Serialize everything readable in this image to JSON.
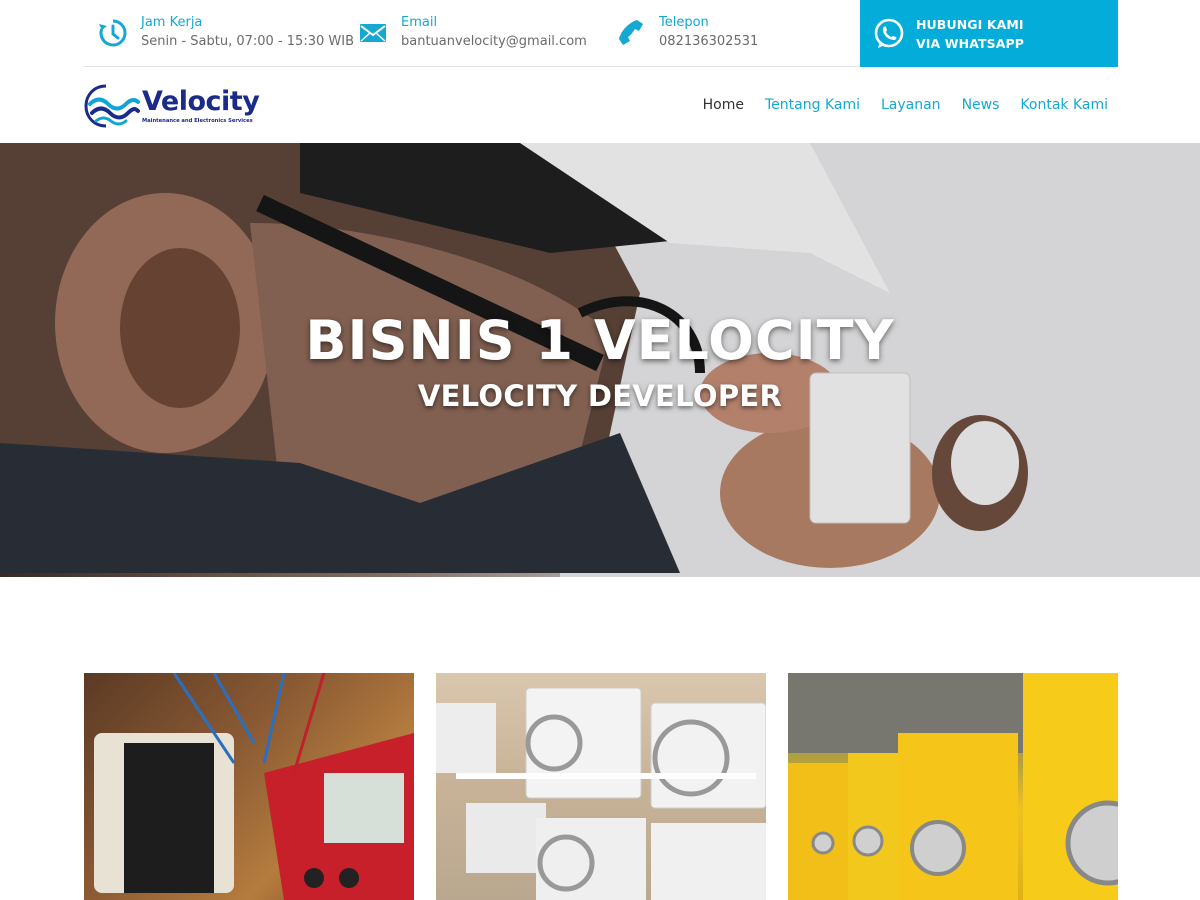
{
  "topbar": {
    "jam": {
      "label": "Jam Kerja",
      "value": "Senin - Sabtu, 07:00 - 15:30 WIB"
    },
    "email": {
      "label": "Email",
      "value": "bantuanvelocity@gmail.com"
    },
    "telepon": {
      "label": "Telepon",
      "value": "082136302531"
    },
    "whatsapp": {
      "line1": "HUBUNGI KAMI",
      "line2": "VIA WHATSAPP"
    }
  },
  "logo": {
    "name": "Velocity",
    "tagline": "Maintenance and Electronics Services"
  },
  "nav": [
    {
      "label": "Home",
      "active": true
    },
    {
      "label": "Tentang Kami",
      "active": false
    },
    {
      "label": "Layanan",
      "active": false
    },
    {
      "label": "News",
      "active": false
    },
    {
      "label": "Kontak Kami",
      "active": false
    }
  ],
  "hero": {
    "title": "BISNIS 1 VELOCITY",
    "subtitle": "VELOCITY DEVELOPER"
  },
  "colors": {
    "accent": "#14a8d3",
    "whatsapp_bg": "#04acd9",
    "brand_dark": "#1b2b8a"
  },
  "icons": {
    "jam": "clock-history-icon",
    "email": "envelope-icon",
    "telepon": "phone-icon",
    "whatsapp": "whatsapp-icon"
  }
}
